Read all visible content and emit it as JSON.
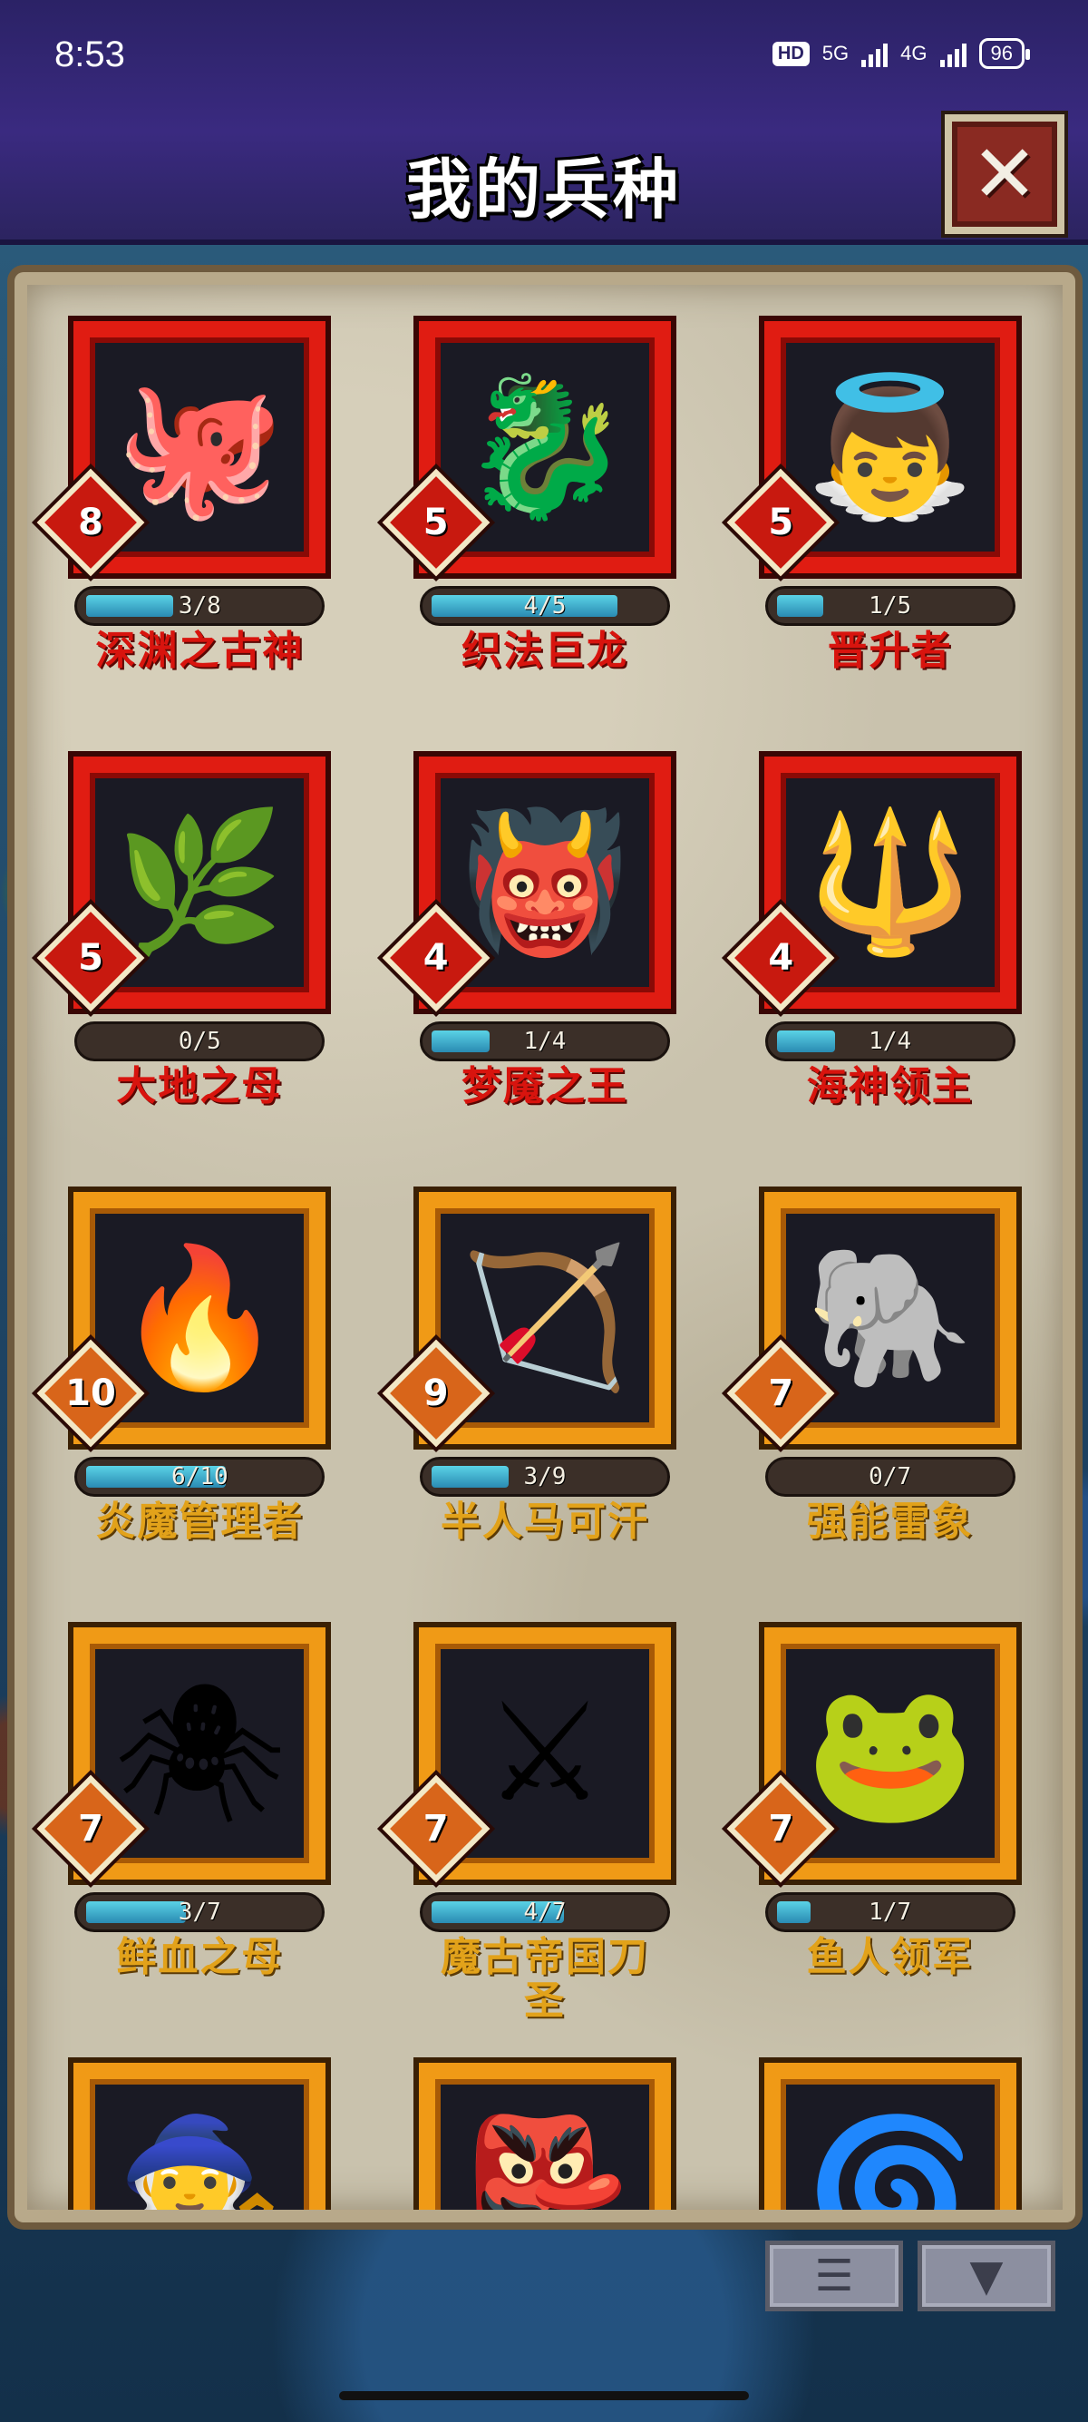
{
  "status_bar": {
    "time": "8:53",
    "hd_label": "HD",
    "net_5g": "5G",
    "net_4g": "4G",
    "battery": "96"
  },
  "header": {
    "title": "我的兵种",
    "close_glyph": "✕"
  },
  "colors": {
    "red_frame": "#e01c12",
    "gold_frame": "#f09a16",
    "red_name": "#d8140e",
    "gold_name": "#e2a21a",
    "progress_fill": "#3aa8c8"
  },
  "units": [
    {
      "name": "深渊之古神",
      "level": "8",
      "progress_text": "3/8",
      "progress": 0.375,
      "tier": "red",
      "icon": "octopus-icon",
      "glyph": "🐙"
    },
    {
      "name": "织法巨龙",
      "level": "5",
      "progress_text": "4/5",
      "progress": 0.8,
      "tier": "red",
      "icon": "dragon-icon",
      "glyph": "🐉"
    },
    {
      "name": "晋升者",
      "level": "5",
      "progress_text": "1/5",
      "progress": 0.2,
      "tier": "red",
      "icon": "angel-icon",
      "glyph": "👼"
    },
    {
      "name": "大地之母",
      "level": "5",
      "progress_text": "0/5",
      "progress": 0.0,
      "tier": "red",
      "icon": "earth-mother-icon",
      "glyph": "🌿"
    },
    {
      "name": "梦魇之王",
      "level": "4",
      "progress_text": "1/4",
      "progress": 0.25,
      "tier": "red",
      "icon": "demon-icon",
      "glyph": "👹"
    },
    {
      "name": "海神领主",
      "level": "4",
      "progress_text": "1/4",
      "progress": 0.25,
      "tier": "red",
      "icon": "sea-lord-icon",
      "glyph": "🔱"
    },
    {
      "name": "炎魔管理者",
      "level": "10",
      "progress_text": "6/10",
      "progress": 0.6,
      "tier": "gold",
      "icon": "fire-demon-icon",
      "glyph": "🔥"
    },
    {
      "name": "半人马可汗",
      "level": "9",
      "progress_text": "3/9",
      "progress": 0.333,
      "tier": "gold",
      "icon": "centaur-icon",
      "glyph": "🏹"
    },
    {
      "name": "强能雷象",
      "level": "7",
      "progress_text": "0/7",
      "progress": 0.0,
      "tier": "gold",
      "icon": "thunder-elephant-icon",
      "glyph": "🐘"
    },
    {
      "name": "鲜血之母",
      "level": "7",
      "progress_text": "3/7",
      "progress": 0.4286,
      "tier": "gold",
      "icon": "spider-icon",
      "glyph": "🕷"
    },
    {
      "name": "魔古帝国刀圣",
      "level": "7",
      "progress_text": "4/7",
      "progress": 0.5714,
      "tier": "gold",
      "icon": "warrior-icon",
      "glyph": "⚔"
    },
    {
      "name": "鱼人领军",
      "level": "7",
      "progress_text": "1/7",
      "progress": 0.1429,
      "tier": "gold",
      "icon": "murloc-icon",
      "glyph": "🐸"
    },
    {
      "name": "",
      "level": "",
      "progress_text": "",
      "progress": 0.0,
      "tier": "gold",
      "icon": "witch-icon",
      "glyph": "🧙"
    },
    {
      "name": "",
      "level": "",
      "progress_text": "",
      "progress": 0.0,
      "tier": "gold",
      "icon": "orc-icon",
      "glyph": "👺"
    },
    {
      "name": "",
      "level": "",
      "progress_text": "",
      "progress": 0.0,
      "tier": "gold",
      "icon": "elemental-icon",
      "glyph": "🌀"
    }
  ],
  "toolbar": {
    "list_icon": "list-icon",
    "list_glyph": "☰",
    "filter_icon": "filter-icon",
    "filter_glyph": "▼"
  }
}
